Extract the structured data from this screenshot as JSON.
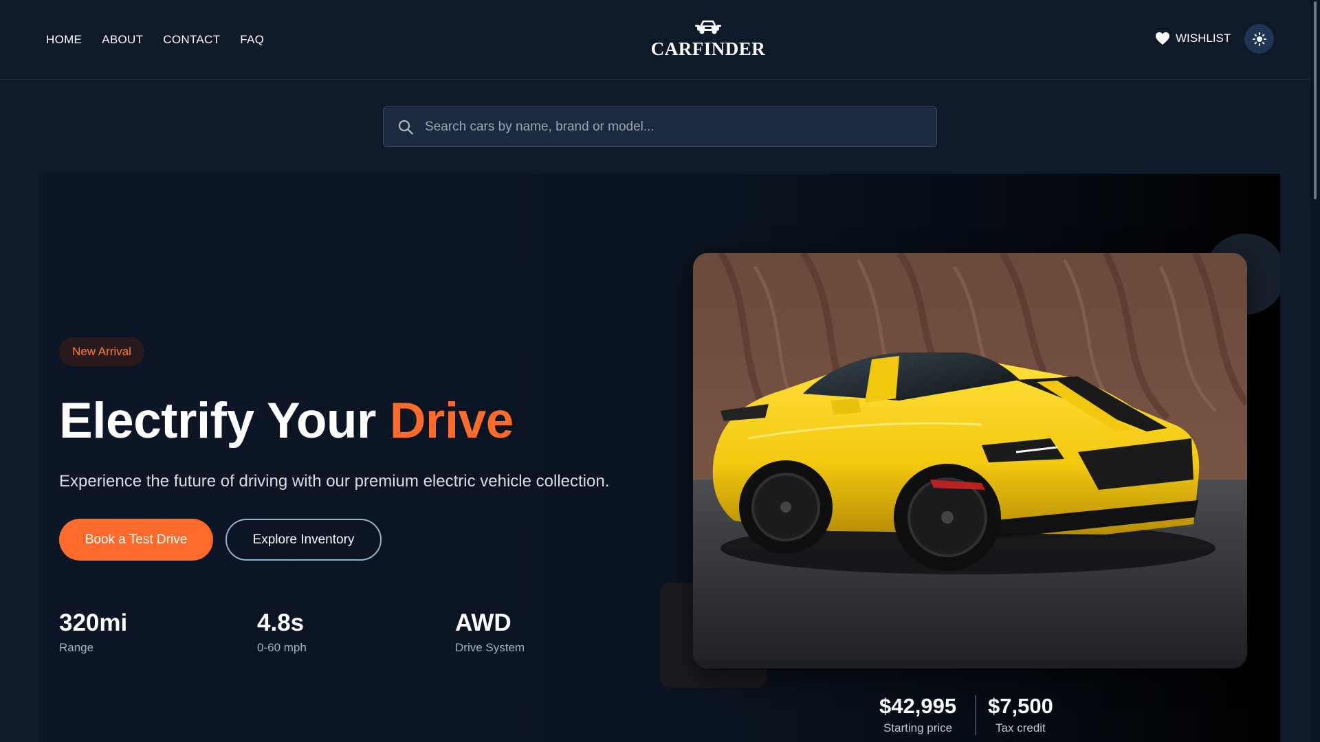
{
  "nav": {
    "items": [
      {
        "label": "HOME"
      },
      {
        "label": "ABOUT"
      },
      {
        "label": "CONTACT"
      },
      {
        "label": "FAQ"
      }
    ]
  },
  "brand": {
    "name": "CARFINDER",
    "icon": "car-icon"
  },
  "header": {
    "wishlist_label": "WISHLIST",
    "wishlist_icon": "heart-icon",
    "theme_icon": "sun-icon"
  },
  "search": {
    "placeholder": "Search cars by name, brand or model...",
    "value": "",
    "icon": "search-icon"
  },
  "hero": {
    "badge": "New Arrival",
    "title_main": "Electrify Your ",
    "title_accent": "Drive",
    "subtitle": "Experience the future of driving with our premium electric vehicle collection.",
    "primary_button": "Book a Test Drive",
    "secondary_button": "Explore Inventory",
    "stats": [
      {
        "value": "320mi",
        "label": "Range"
      },
      {
        "value": "4.8s",
        "label": "0-60 mph"
      },
      {
        "value": "AWD",
        "label": "Drive System"
      }
    ],
    "pricing": [
      {
        "value": "$42,995",
        "label": "Starting price"
      },
      {
        "value": "$7,500",
        "label": "Tax credit"
      }
    ]
  },
  "colors": {
    "background": "#0f1a2b",
    "accent": "#ff6b2c",
    "button_outline": "#8fb3cf",
    "car_body": "#f2c80f"
  }
}
